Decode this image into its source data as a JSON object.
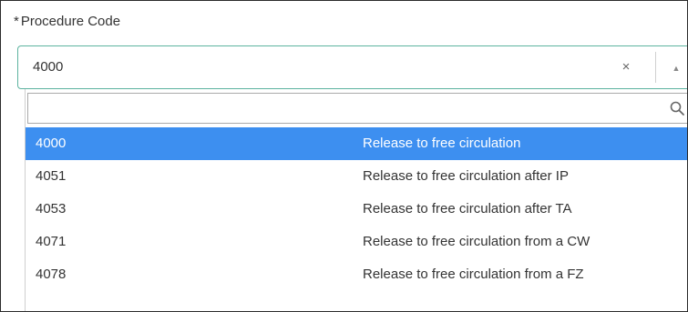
{
  "field": {
    "required_marker": "*",
    "label": "Procedure Code",
    "selected_value": "4000",
    "clear_symbol": "×",
    "toggle_symbol": "▲"
  },
  "dropdown": {
    "search_value": "",
    "search_icon": "search-icon",
    "options": [
      {
        "code": "4000",
        "description": "Release to free circulation",
        "selected": true
      },
      {
        "code": "4051",
        "description": "Release to free circulation after IP",
        "selected": false
      },
      {
        "code": "4053",
        "description": "Release to free circulation after TA",
        "selected": false
      },
      {
        "code": "4071",
        "description": "Release to free circulation from a CW",
        "selected": false
      },
      {
        "code": "4078",
        "description": "Release to free circulation from a FZ",
        "selected": false
      }
    ]
  },
  "colors": {
    "highlight": "#3d8ff0",
    "focus_border": "#5cb39f",
    "text": "#333333"
  }
}
